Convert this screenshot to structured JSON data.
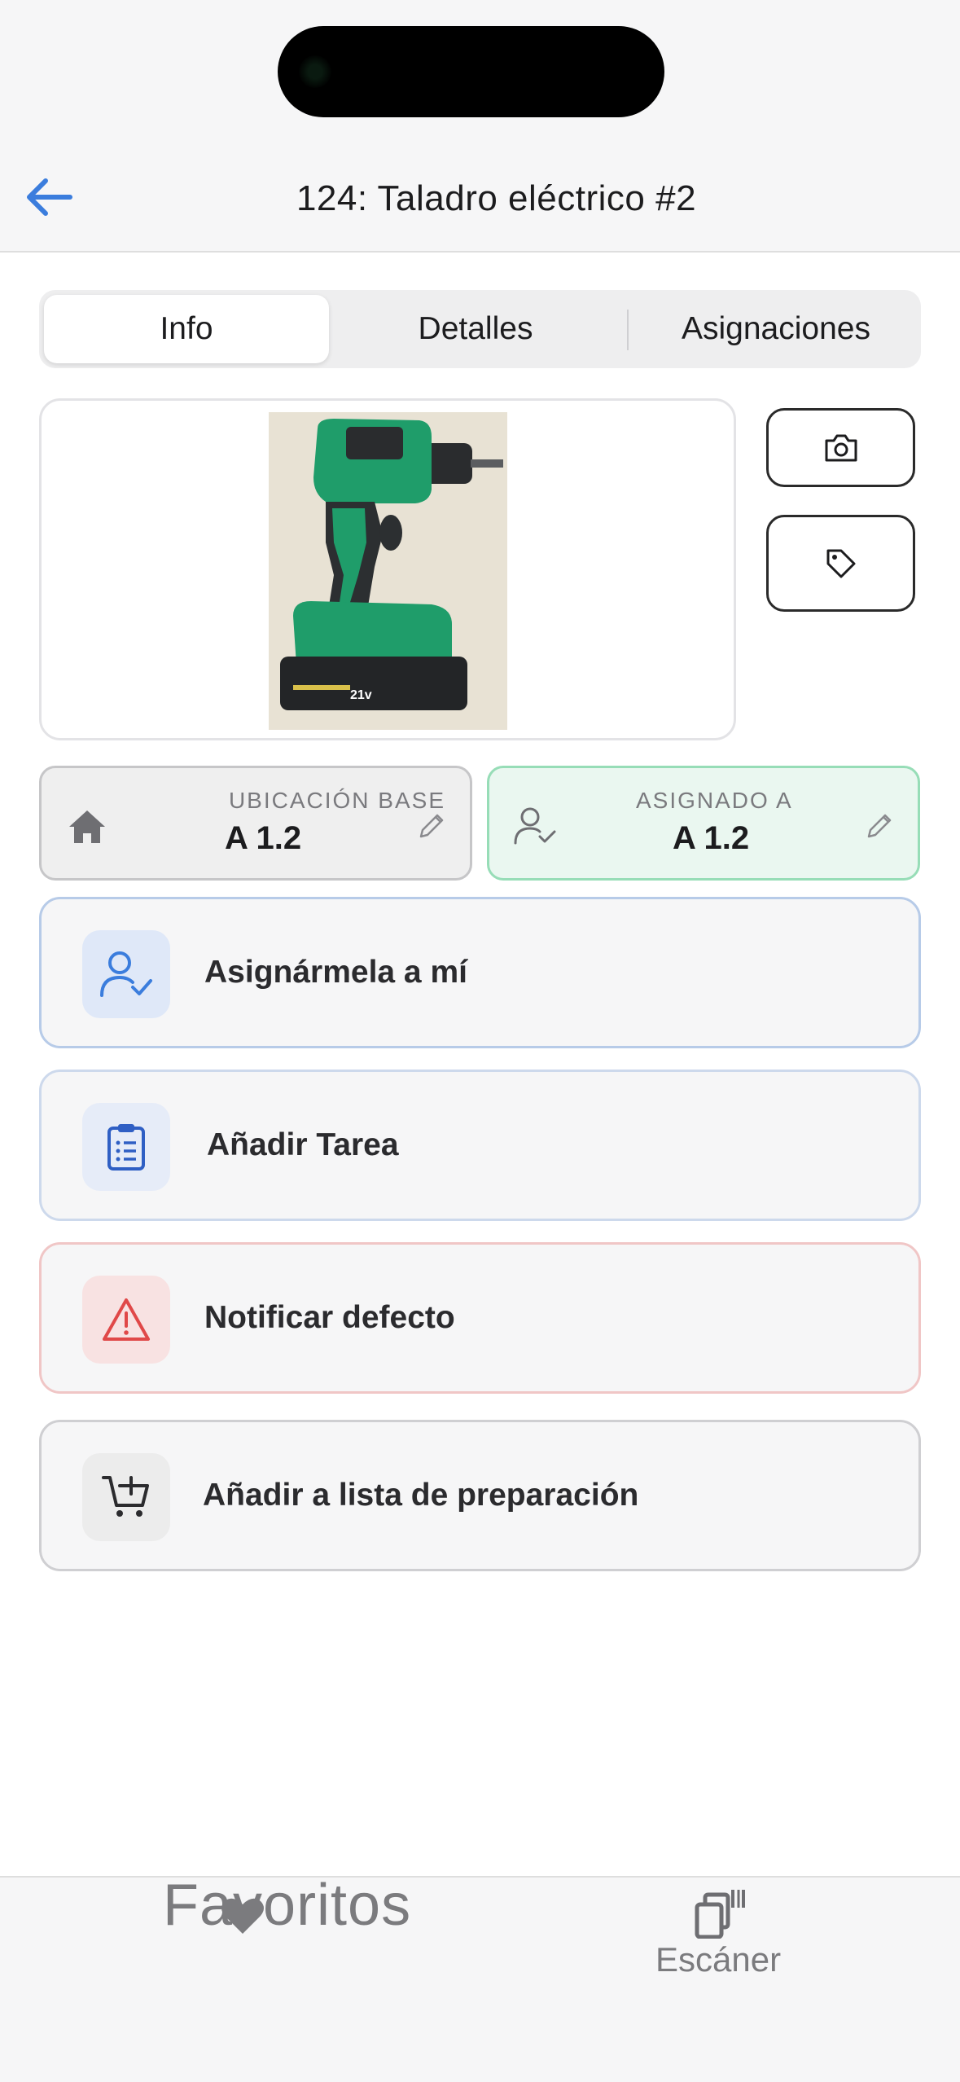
{
  "header": {
    "title": "124: Taladro eléctrico #2"
  },
  "tabs": [
    {
      "label": "Info",
      "active": true
    },
    {
      "label": "Detalles",
      "active": false
    },
    {
      "label": "Asignaciones",
      "active": false
    }
  ],
  "photo": {
    "battery_voltage": "21v"
  },
  "icons": {
    "back": "arrow-left-icon",
    "camera": "camera-icon",
    "tag": "tag-icon",
    "home": "home-icon",
    "user_check": "user-check-icon",
    "edit": "pencil-icon",
    "clipboard": "clipboard-list-icon",
    "alert": "alert-triangle-icon",
    "cart": "cart-plus-icon",
    "heart": "heart-icon",
    "scanner": "scanner-icon"
  },
  "location": {
    "label": "UBICACIÓN BASE",
    "value": "A 1.2"
  },
  "assigned": {
    "label": "ASIGNADO A",
    "value": "A 1.2"
  },
  "actions": [
    {
      "label": "Asignármela a mí"
    },
    {
      "label": "Añadir Tarea"
    },
    {
      "label": "Notificar defecto"
    },
    {
      "label": "Añadir a lista de preparación"
    }
  ],
  "tabbar": {
    "favorites_label": "Favoritos",
    "scanner_label": "Escáner"
  },
  "colors": {
    "accent_blue": "#3b7ddd",
    "assigned_green": "#97ddb7",
    "danger_red": "#e04848",
    "drill_green": "#1f9d6a"
  }
}
